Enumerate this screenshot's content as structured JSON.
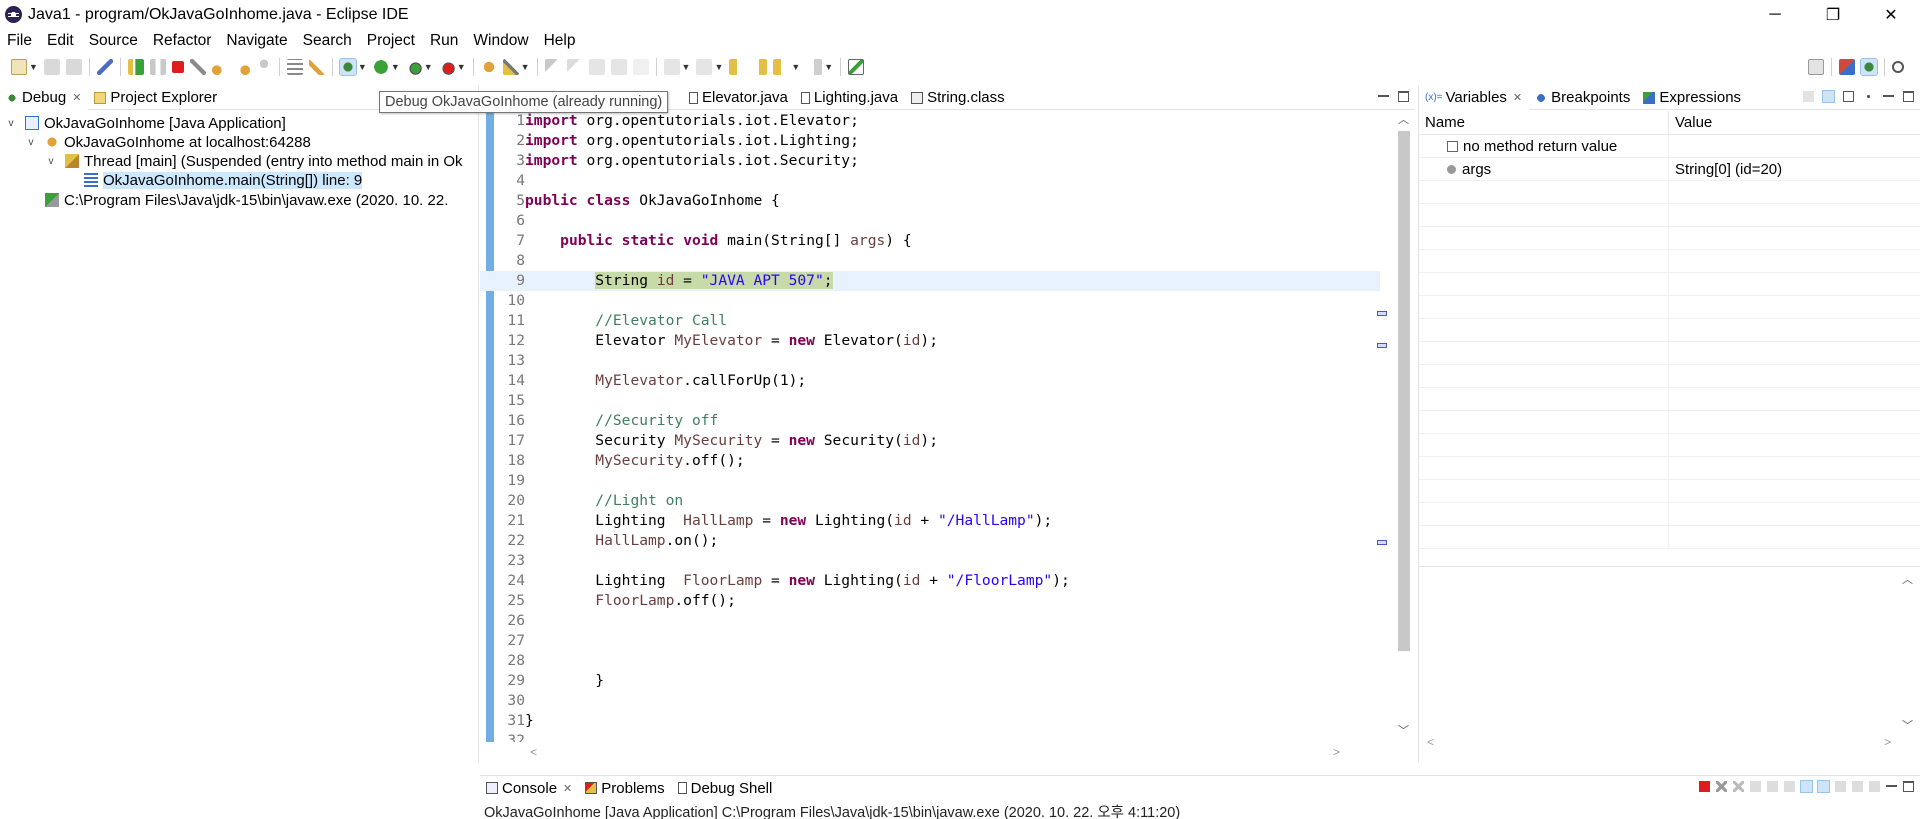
{
  "window": {
    "title": "Java1 - program/OkJavaGoInhome.java - Eclipse IDE",
    "controls": [
      "─",
      "❐",
      "✕"
    ]
  },
  "menubar": {
    "items": [
      "File",
      "Edit",
      "Source",
      "Refactor",
      "Navigate",
      "Search",
      "Project",
      "Run",
      "Window",
      "Help"
    ]
  },
  "tooltip": "Debug OkJavaGoInhome (already running)",
  "debug_view": {
    "tabs": [
      {
        "label": "Debug",
        "icon": "debug-icon",
        "close": "✕"
      },
      {
        "label": "Project Explorer",
        "icon": "project-explorer-icon"
      }
    ],
    "tree": [
      {
        "label": "OkJavaGoInhome [Java Application]",
        "twisty": "v",
        "icon": "java-app-icon"
      },
      {
        "label": "OkJavaGoInhome at localhost:64288",
        "twisty": "v",
        "icon": "vm-icon"
      },
      {
        "label": "Thread [main] (Suspended (entry into method main in Ok",
        "twisty": "v",
        "icon": "thread-suspended-icon"
      },
      {
        "label": "OkJavaGoInhome.main(String[]) line: 9",
        "twisty": "",
        "icon": "stack-frame-icon",
        "selected": true
      },
      {
        "label": "C:\\Program Files\\Java\\jdk-15\\bin\\javaw.exe (2020. 10. 22.",
        "twisty": "",
        "icon": "process-icon"
      }
    ]
  },
  "editor": {
    "tabs": [
      {
        "label": "Elevator.java",
        "icon": "java-file-icon"
      },
      {
        "label": "Lighting.java",
        "icon": "java-file-icon"
      },
      {
        "label": "String.class",
        "icon": "class-file-icon"
      }
    ],
    "lines": [
      {
        "n": "1",
        "html": "<span class='kw'>import</span> org.opentutorials.iot.Elevator;"
      },
      {
        "n": "2",
        "html": "<span class='kw'>import</span> org.opentutorials.iot.Lighting;"
      },
      {
        "n": "3",
        "html": "<span class='kw'>import</span> org.opentutorials.iot.Security;"
      },
      {
        "n": "4",
        "html": ""
      },
      {
        "n": "5",
        "html": "<span class='kw'>public</span> <span class='kw'>class</span> OkJavaGoInhome {"
      },
      {
        "n": "6",
        "html": ""
      },
      {
        "n": "7",
        "html": "    <span class='kw'>public</span> <span class='kw'>static</span> <span class='kw'>void</span> main(String[] <span class='vr'>args</span>) {"
      },
      {
        "n": "8",
        "html": ""
      },
      {
        "n": "9",
        "html": "        <span class='code-hl'>String <span class='vr'>id</span> = <span class='st'>\"JAVA APT 507\"</span>;</span>",
        "current": true
      },
      {
        "n": "10",
        "html": ""
      },
      {
        "n": "11",
        "html": "        <span class='cm'>//Elevator Call</span>"
      },
      {
        "n": "12",
        "html": "        Elevator <span class='vr'>MyElevator</span> = <span class='kw'>new</span> Elevator(<span class='vr'>id</span>);"
      },
      {
        "n": "13",
        "html": ""
      },
      {
        "n": "14",
        "html": "        <span class='vr'>MyElevator</span>.callForUp(1);"
      },
      {
        "n": "15",
        "html": ""
      },
      {
        "n": "16",
        "html": "        <span class='cm'>//Security off</span>"
      },
      {
        "n": "17",
        "html": "        Security <span class='vr'>MySecurity</span> = <span class='kw'>new</span> Security(<span class='vr'>id</span>);"
      },
      {
        "n": "18",
        "html": "        <span class='vr'>MySecurity</span>.off();"
      },
      {
        "n": "19",
        "html": ""
      },
      {
        "n": "20",
        "html": "        <span class='cm'>//Light on</span>"
      },
      {
        "n": "21",
        "html": "        Lighting  <span class='vr'>HallLamp</span> = <span class='kw'>new</span> Lighting(<span class='vr'>id</span> + <span class='st'>\"/HallLamp\"</span>);"
      },
      {
        "n": "22",
        "html": "        <span class='vr'>HallLamp</span>.on();"
      },
      {
        "n": "23",
        "html": ""
      },
      {
        "n": "24",
        "html": "        Lighting  <span class='vr'>FloorLamp</span> = <span class='kw'>new</span> Lighting(<span class='vr'>id</span> + <span class='st'>\"/FloorLamp\"</span>);"
      },
      {
        "n": "25",
        "html": "        <span class='vr'>FloorLamp</span>.off();"
      },
      {
        "n": "26",
        "html": ""
      },
      {
        "n": "27",
        "html": ""
      },
      {
        "n": "28",
        "html": ""
      },
      {
        "n": "29",
        "html": "        }"
      },
      {
        "n": "30",
        "html": ""
      },
      {
        "n": "31",
        "html": "}"
      },
      {
        "n": "32",
        "html": ""
      }
    ]
  },
  "variables_view": {
    "tabs": [
      {
        "label": "Variables",
        "icon": "variables-icon",
        "prefix": "(x)=",
        "close": "✕"
      },
      {
        "label": "Breakpoints",
        "icon": "breakpoints-icon"
      },
      {
        "label": "Expressions",
        "icon": "expressions-icon"
      }
    ],
    "columns": [
      "Name",
      "Value"
    ],
    "rows": [
      {
        "name": "no method return value",
        "value": "",
        "icon": "return-value-icon"
      },
      {
        "name": "args",
        "value": "String[0]  (id=20)",
        "icon": "local-variable-icon"
      }
    ]
  },
  "console_view": {
    "tabs": [
      {
        "label": "Console",
        "icon": "console-icon",
        "close": "✕"
      },
      {
        "label": "Problems",
        "icon": "problems-icon"
      },
      {
        "label": "Debug Shell",
        "icon": "debug-shell-icon"
      }
    ],
    "subtitle": "OkJavaGoInhome [Java Application] C:\\Program Files\\Java\\jdk-15\\bin\\javaw.exe  (2020. 10. 22. 오후 4:11:20)"
  },
  "colors": {
    "keyword": "#7f0055",
    "comment": "#3f7f5f",
    "string": "#2a00ff",
    "variable": "#6a3e3e",
    "selection": "#cce8ff",
    "current_line_highlight": "#c6dba8",
    "gutter_marker": "#5a9fe0",
    "terminate": "#e01d1d"
  }
}
